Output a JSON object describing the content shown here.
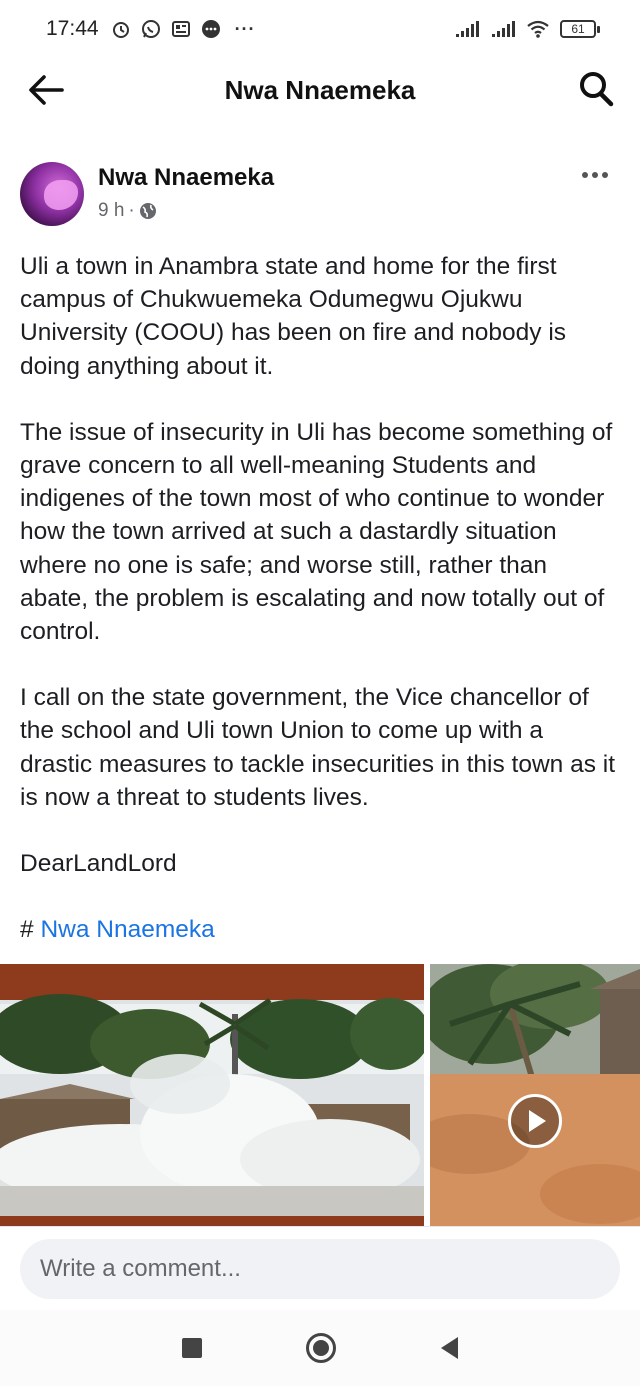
{
  "status_bar": {
    "time": "17:44",
    "more": "···",
    "battery": "61"
  },
  "header": {
    "title": "Nwa Nnaemeka"
  },
  "post": {
    "author": "Nwa Nnaemeka",
    "time": "9 h",
    "separator": "·",
    "paragraphs": [
      "Uli a town in Anambra state and home for the first campus of Chukwuemeka Odumegwu Ojukwu University (COOU) has been on fire and nobody is doing anything about it.",
      "The issue of insecurity in Uli has become something of grave concern to all well-meaning Students and indigenes of the town most of who continue to wonder how the town arrived at such a dastardly situation where no one is safe; and worse still, rather than abate, the problem is escalating and now totally out of control.",
      "I call on the state government, the Vice chancellor of the school and Uli town Union to come up with a drastic measures to tackle insecurities in this town as it is now a threat to students lives.",
      "DearLandLord"
    ],
    "hashtag_symbol": "#",
    "hashtag_text": "Nwa Nnaemeka"
  },
  "comment": {
    "placeholder": "Write a comment..."
  },
  "colors": {
    "link": "#1b74e4",
    "meta": "#65676b",
    "input_bg": "#f0f2f5"
  },
  "icons": {
    "back": "arrow-left-icon",
    "search": "search-icon",
    "more": "more-horizontal-icon",
    "privacy": "globe-icon",
    "play": "play-icon"
  }
}
